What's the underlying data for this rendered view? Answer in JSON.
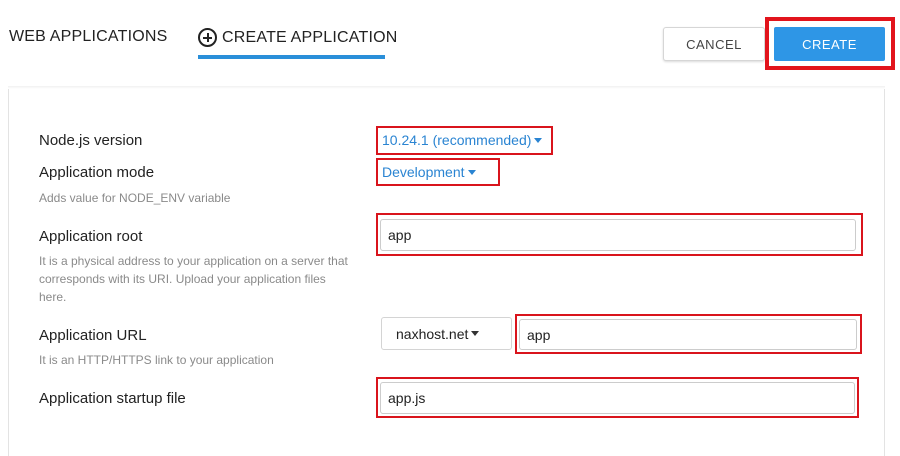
{
  "header": {
    "tab_web_applications": "WEB APPLICATIONS",
    "tab_create_application": "CREATE APPLICATION",
    "cancel_label": "CANCEL",
    "create_label": "CREATE"
  },
  "form": {
    "node_version": {
      "label": "Node.js version",
      "value": "10.24.1 (recommended)"
    },
    "app_mode": {
      "label": "Application mode",
      "value": "Development",
      "help": "Adds value for NODE_ENV variable"
    },
    "app_root": {
      "label": "Application root",
      "value": "app",
      "help": "It is a physical address to your application on a server that corresponds with its URI. Upload your application files here."
    },
    "app_url": {
      "label": "Application URL",
      "domain": "naxhost.net",
      "value": "app",
      "help": "It is an HTTP/HTTPS link to your application"
    },
    "startup_file": {
      "label": "Application startup file",
      "value": "app.js"
    }
  },
  "colors": {
    "accent": "#2e96e6",
    "highlight": "#d9141c",
    "link": "#2a84d2"
  }
}
